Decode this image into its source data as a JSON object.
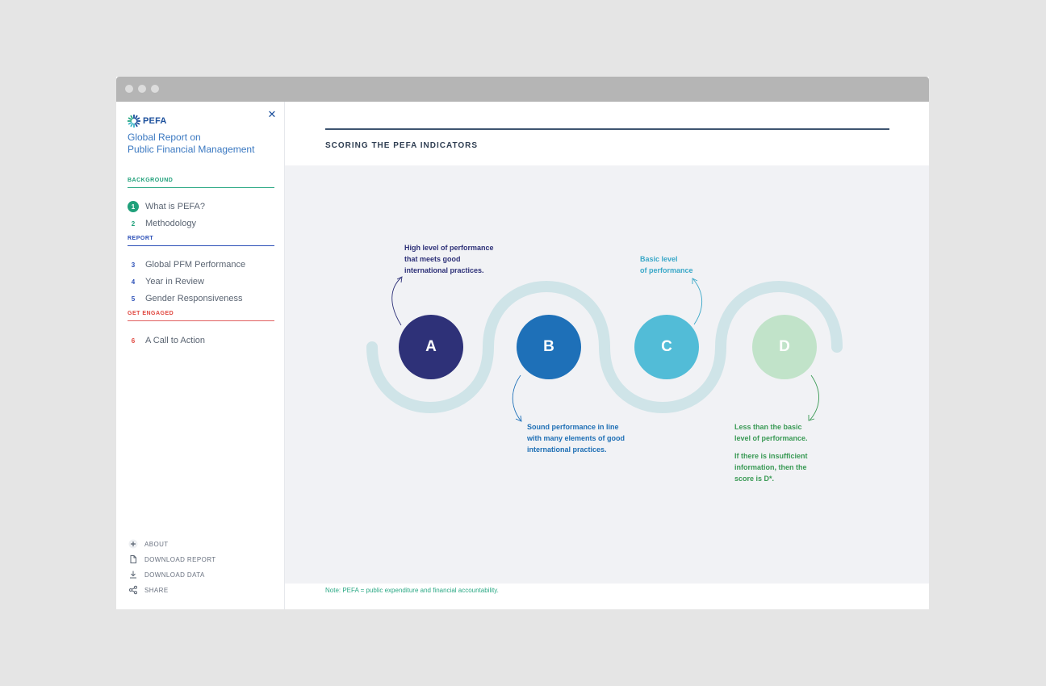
{
  "app": {
    "logo_text": "PEFA",
    "report_title_line1": "Global Report on",
    "report_title_line2": "Public Financial Management",
    "close_glyph": "✕"
  },
  "sections": {
    "background": "BACKGROUND",
    "report": "REPORT",
    "engaged": "GET ENGAGED"
  },
  "nav": [
    {
      "num": "1",
      "label": "What is PEFA?",
      "active": true
    },
    {
      "num": "2",
      "label": "Methodology"
    },
    {
      "num": "3",
      "label": "Global PFM Performance"
    },
    {
      "num": "4",
      "label": "Year in Review"
    },
    {
      "num": "5",
      "label": "Gender Responsiveness"
    },
    {
      "num": "6",
      "label": "A Call to Action"
    }
  ],
  "footer": [
    {
      "label": "ABOUT",
      "icon": "plus-icon"
    },
    {
      "label": "DOWNLOAD REPORT",
      "icon": "document-icon"
    },
    {
      "label": "DOWNLOAD DATA",
      "icon": "download-icon"
    },
    {
      "label": "SHARE",
      "icon": "share-icon"
    }
  ],
  "main": {
    "title": "SCORING THE PEFA INDICATORS",
    "note": "Note: PEFA = public expenditure and financial accountability."
  },
  "scores": [
    {
      "letter": "A",
      "color": "#2e3178",
      "text_color": "#2e3178",
      "desc": [
        "High level of performance",
        "that meets good",
        "international practices."
      ]
    },
    {
      "letter": "B",
      "color": "#1e70b8",
      "text_color": "#1e6fb5",
      "desc": [
        "Sound performance in line",
        "with many elements of good",
        "international practices."
      ]
    },
    {
      "letter": "C",
      "color": "#52bcd7",
      "text_color": "#3aa8c8",
      "desc": [
        "Basic level",
        "of performance"
      ]
    },
    {
      "letter": "D",
      "color": "#c1e3c9",
      "text_color": "#3a9a55",
      "desc": [
        "Less than the basic",
        "level of performance."
      ],
      "desc2": [
        "If there is insufficient",
        "information, then the",
        "score is D*."
      ]
    }
  ],
  "colors": {
    "accent_green": "#1fa07a",
    "accent_blue": "#2b4fb7",
    "accent_red": "#e0463e",
    "wave": "#cfe4e8"
  }
}
